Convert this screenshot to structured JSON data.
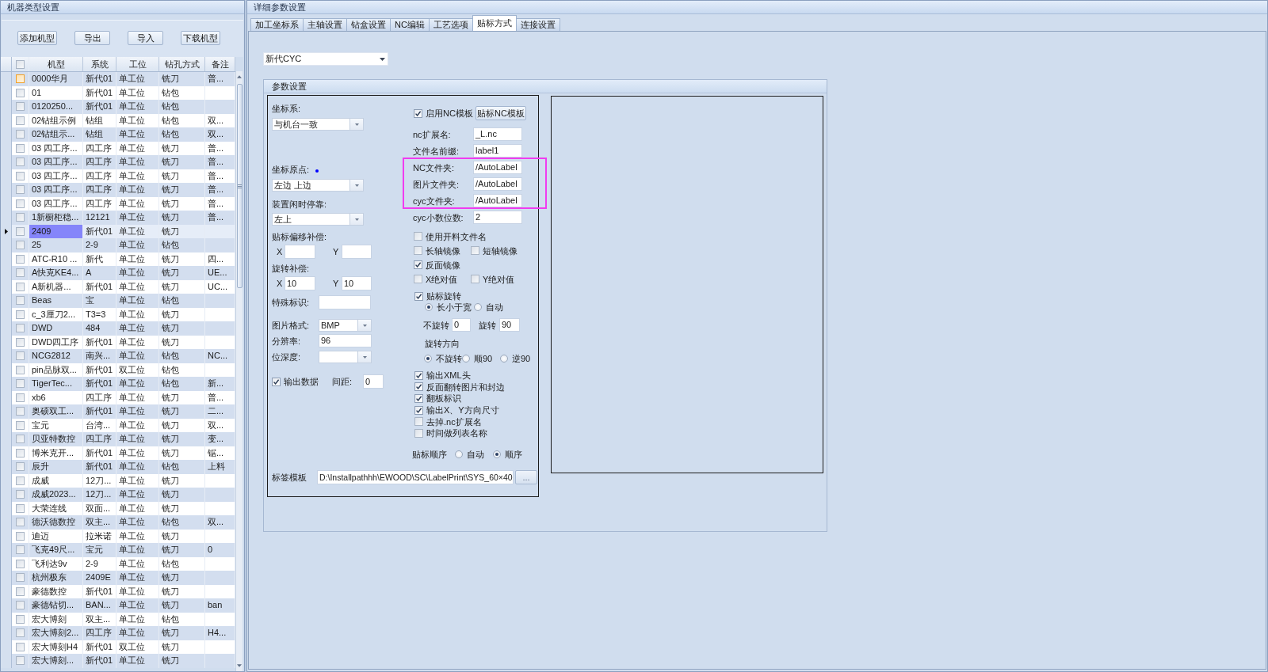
{
  "machine_panel": {
    "title": "机器类型设置",
    "buttons": [
      "添加机型",
      "导出",
      "导入",
      "下载机型"
    ],
    "table": {
      "columns": [
        "机型",
        "系统",
        "工位",
        "钻孔方式",
        "备注"
      ],
      "header_checked": false,
      "rows": [
        {
          "cells": [
            "0000华月",
            "新代01",
            "单工位",
            "铣刀",
            "普..."
          ],
          "checked": false,
          "focused": true,
          "selected": false
        },
        {
          "cells": [
            "01",
            "新代01",
            "单工位",
            "钻包"
          ],
          "checked": false,
          "focused": false,
          "selected": false
        },
        {
          "cells": [
            "0120250...",
            "新代01",
            "单工位",
            "钻包"
          ],
          "checked": false,
          "focused": false,
          "selected": false
        },
        {
          "cells": [
            "02钻组示例",
            "钻组",
            "单工位",
            "钻包",
            "双..."
          ],
          "checked": false,
          "focused": false,
          "selected": false
        },
        {
          "cells": [
            "02钻组示...",
            "钻组",
            "单工位",
            "钻包",
            "双..."
          ],
          "checked": false,
          "focused": false,
          "selected": false
        },
        {
          "cells": [
            "03 四工序...",
            "四工序",
            "单工位",
            "铣刀",
            "普..."
          ],
          "checked": false,
          "focused": false,
          "selected": false
        },
        {
          "cells": [
            "03 四工序...",
            "四工序",
            "单工位",
            "铣刀",
            "普..."
          ],
          "checked": false,
          "focused": false,
          "selected": false
        },
        {
          "cells": [
            "03 四工序...",
            "四工序",
            "单工位",
            "铣刀",
            "普..."
          ],
          "checked": false,
          "focused": false,
          "selected": false
        },
        {
          "cells": [
            "03 四工序...",
            "四工序",
            "单工位",
            "铣刀",
            "普..."
          ],
          "checked": false,
          "focused": false,
          "selected": false
        },
        {
          "cells": [
            "03 四工序...",
            "四工序",
            "单工位",
            "铣刀",
            "普..."
          ],
          "checked": false,
          "focused": false,
          "selected": false
        },
        {
          "cells": [
            "1新橱柜稳...",
            "12121",
            "单工位",
            "铣刀",
            "普..."
          ],
          "checked": false,
          "focused": false,
          "selected": false
        },
        {
          "cells": [
            "2409",
            "新代01",
            "单工位",
            "铣刀"
          ],
          "checked": false,
          "focused": false,
          "selected": true
        },
        {
          "cells": [
            "25",
            "2-9",
            "单工位",
            "钻包"
          ],
          "checked": false,
          "focused": false,
          "selected": false
        },
        {
          "cells": [
            "ATC-R10 ...",
            "新代",
            "单工位",
            "铣刀",
            "四..."
          ],
          "checked": false,
          "focused": false,
          "selected": false
        },
        {
          "cells": [
            "A快克KE4...",
            "A",
            "单工位",
            "铣刀",
            "UE..."
          ],
          "checked": false,
          "focused": false,
          "selected": false
        },
        {
          "cells": [
            "A新机器...",
            "新代01",
            "单工位",
            "铣刀",
            "UC..."
          ],
          "checked": false,
          "focused": false,
          "selected": false
        },
        {
          "cells": [
            "Beas",
            "宝",
            "单工位",
            "钻包"
          ],
          "checked": false,
          "focused": false,
          "selected": false
        },
        {
          "cells": [
            "c_3厘刀2...",
            "T3=3",
            "单工位",
            "铣刀"
          ],
          "checked": false,
          "focused": false,
          "selected": false
        },
        {
          "cells": [
            "DWD",
            "484",
            "单工位",
            "铣刀"
          ],
          "checked": false,
          "focused": false,
          "selected": false
        },
        {
          "cells": [
            "DWD四工序",
            "新代01",
            "单工位",
            "铣刀"
          ],
          "checked": false,
          "focused": false,
          "selected": false
        },
        {
          "cells": [
            "NCG2812",
            "南兴...",
            "单工位",
            "钻包",
            "NC..."
          ],
          "checked": false,
          "focused": false,
          "selected": false
        },
        {
          "cells": [
            "pin品脉双...",
            "新代01",
            "双工位",
            "钻包"
          ],
          "checked": false,
          "focused": false,
          "selected": false
        },
        {
          "cells": [
            "TigerTec...",
            "新代01",
            "单工位",
            "钻包",
            "新..."
          ],
          "checked": false,
          "focused": false,
          "selected": false
        },
        {
          "cells": [
            "xb6",
            "四工序",
            "单工位",
            "铣刀",
            "普..."
          ],
          "checked": false,
          "focused": false,
          "selected": false
        },
        {
          "cells": [
            "奥硕双工...",
            "新代01",
            "单工位",
            "铣刀",
            "二..."
          ],
          "checked": false,
          "focused": false,
          "selected": false
        },
        {
          "cells": [
            "宝元",
            "台湾...",
            "单工位",
            "铣刀",
            "双..."
          ],
          "checked": false,
          "focused": false,
          "selected": false
        },
        {
          "cells": [
            "贝亚特数控",
            "四工序",
            "单工位",
            "铣刀",
            "变..."
          ],
          "checked": false,
          "focused": false,
          "selected": false
        },
        {
          "cells": [
            "博米克开...",
            "新代01",
            "单工位",
            "铣刀",
            "锯..."
          ],
          "checked": false,
          "focused": false,
          "selected": false
        },
        {
          "cells": [
            "辰升",
            "新代01",
            "单工位",
            "钻包",
            "上料"
          ],
          "checked": false,
          "focused": false,
          "selected": false
        },
        {
          "cells": [
            "成威",
            "12刀...",
            "单工位",
            "铣刀"
          ],
          "checked": false,
          "focused": false,
          "selected": false
        },
        {
          "cells": [
            "成威2023...",
            "12刀...",
            "单工位",
            "铣刀"
          ],
          "checked": false,
          "focused": false,
          "selected": false
        },
        {
          "cells": [
            "大荣连线",
            "双面...",
            "单工位",
            "铣刀"
          ],
          "checked": false,
          "focused": false,
          "selected": false
        },
        {
          "cells": [
            "德沃德数控",
            "双主...",
            "单工位",
            "钻包",
            "双..."
          ],
          "checked": false,
          "focused": false,
          "selected": false
        },
        {
          "cells": [
            "迪迈",
            "拉米诺",
            "单工位",
            "铣刀"
          ],
          "checked": false,
          "focused": false,
          "selected": false
        },
        {
          "cells": [
            "飞克49尺...",
            "宝元",
            "单工位",
            "铣刀",
            "0"
          ],
          "checked": false,
          "focused": false,
          "selected": false
        },
        {
          "cells": [
            "飞利达9v",
            "2-9",
            "单工位",
            "钻包"
          ],
          "checked": false,
          "focused": false,
          "selected": false
        },
        {
          "cells": [
            "杭州极东",
            "2409E",
            "单工位",
            "铣刀"
          ],
          "checked": false,
          "focused": false,
          "selected": false
        },
        {
          "cells": [
            "豪德数控",
            "新代01",
            "单工位",
            "铣刀"
          ],
          "checked": false,
          "focused": false,
          "selected": false
        },
        {
          "cells": [
            "豪德钻切...",
            "BAN...",
            "单工位",
            "铣刀",
            "ban"
          ],
          "checked": false,
          "focused": false,
          "selected": false
        },
        {
          "cells": [
            "宏大博刻",
            "双主...",
            "单工位",
            "钻包"
          ],
          "checked": false,
          "focused": false,
          "selected": false
        },
        {
          "cells": [
            "宏大博刻2...",
            "四工序",
            "单工位",
            "铣刀",
            "H4..."
          ],
          "checked": false,
          "focused": false,
          "selected": false
        },
        {
          "cells": [
            "宏大博刻H4",
            "新代01",
            "双工位",
            "铣刀"
          ],
          "checked": false,
          "focused": false,
          "selected": false
        },
        {
          "cells": [
            "宏大博刻...",
            "新代01",
            "单工位",
            "铣刀"
          ],
          "checked": false,
          "focused": false,
          "selected": false
        }
      ]
    }
  },
  "detail_panel": {
    "title": "详细参数设置",
    "tabs": [
      {
        "label": "加工坐标系",
        "selected": false
      },
      {
        "label": "主轴设置",
        "selected": false
      },
      {
        "label": "钻盒设置",
        "selected": false
      },
      {
        "label": "NC编辑",
        "selected": false
      },
      {
        "label": "工艺选项",
        "selected": false
      },
      {
        "label": "贴标方式",
        "selected": true
      },
      {
        "label": "连接设置",
        "selected": false
      }
    ],
    "controller_select": {
      "value": "新代CYC"
    },
    "params_group": {
      "title": "参数设置",
      "coordinate_system": {
        "label": "坐标系:",
        "value": "与机台一致"
      },
      "origin": {
        "label": "坐标原点:",
        "value": "左边 上边"
      },
      "idle_park": {
        "label": "装置闲时停靠:",
        "value": "左上"
      },
      "label_offset": {
        "label": "贴标偏移补偿:",
        "x_label": "X",
        "y_label": "Y"
      },
      "rotation_offset": {
        "label": "旋转补偿:",
        "x_label": "X",
        "x_value": "10",
        "y_label": "Y",
        "y_value": "10"
      },
      "special_mark": {
        "label": "特殊标识:"
      },
      "image_format": {
        "label": "图片格式:",
        "value": "BMP"
      },
      "resolution": {
        "label": "分辨率:",
        "value": "96"
      },
      "bit_depth": {
        "label": "位深度:"
      },
      "output_data": {
        "label": "输出数据",
        "checked": true,
        "spacing_label": "间距:",
        "spacing_value": "0"
      },
      "label_template": {
        "label": "标签模板",
        "value": "D:\\Installpathhh\\EWOOD\\SC\\LabelPrint\\SYS_60×40",
        "button": "..."
      },
      "nc_template": {
        "label": "启用NC模板",
        "checked": true,
        "button": "贴标NC模板"
      },
      "text_fields": [
        {
          "label": "nc扩展名:",
          "value": "_L.nc",
          "highlighted": false
        },
        {
          "label": "文件名前缀:",
          "value": "label1",
          "highlighted": false
        },
        {
          "label": "NC文件夹:",
          "value": "/AutoLabel",
          "highlighted": true
        },
        {
          "label": "图片文件夹:",
          "value": "/AutoLabel",
          "highlighted": true
        },
        {
          "label": "cyc文件夹:",
          "value": "/AutoLabel",
          "highlighted": true
        },
        {
          "label": "cyc小数位数:",
          "value": "2",
          "highlighted": false
        }
      ],
      "option_rows": [
        [
          {
            "label": "使用开料文件名",
            "checked": false
          }
        ],
        [
          {
            "label": "长轴镜像",
            "checked": false
          },
          {
            "label": "短轴镜像",
            "checked": false
          }
        ],
        [
          {
            "label": "反面镜像",
            "checked": true
          }
        ],
        [
          {
            "label": "X绝对值",
            "checked": false
          },
          {
            "label": "Y绝对值",
            "checked": false
          }
        ]
      ],
      "label_rotation": {
        "label": "贴标旋转",
        "checked": true,
        "modes": [
          {
            "label": "长小于宽",
            "selected": true
          },
          {
            "label": "自动",
            "selected": false
          }
        ],
        "no_rotate_label": "不旋转",
        "no_rotate_value": "0",
        "rotate_label": "旋转",
        "rotate_value": "90",
        "direction_label": "旋转方向",
        "directions": [
          {
            "label": "不旋转",
            "selected": true
          },
          {
            "label": "顺90",
            "selected": false
          },
          {
            "label": "逆90",
            "selected": false
          }
        ]
      },
      "output_options": [
        {
          "label": "输出XML头",
          "checked": true
        },
        {
          "label": "反面翻转图片和封边",
          "checked": true
        },
        {
          "label": "翻板标识",
          "checked": true
        },
        {
          "label": "输出X、Y方向尺寸",
          "checked": true
        },
        {
          "label": "去掉.nc扩展名",
          "checked": false
        },
        {
          "label": "时间做列表名称",
          "checked": false
        }
      ],
      "label_order": {
        "label": "贴标顺序",
        "options": [
          {
            "label": "自动",
            "selected": false
          },
          {
            "label": "顺序",
            "selected": true
          }
        ]
      }
    }
  }
}
